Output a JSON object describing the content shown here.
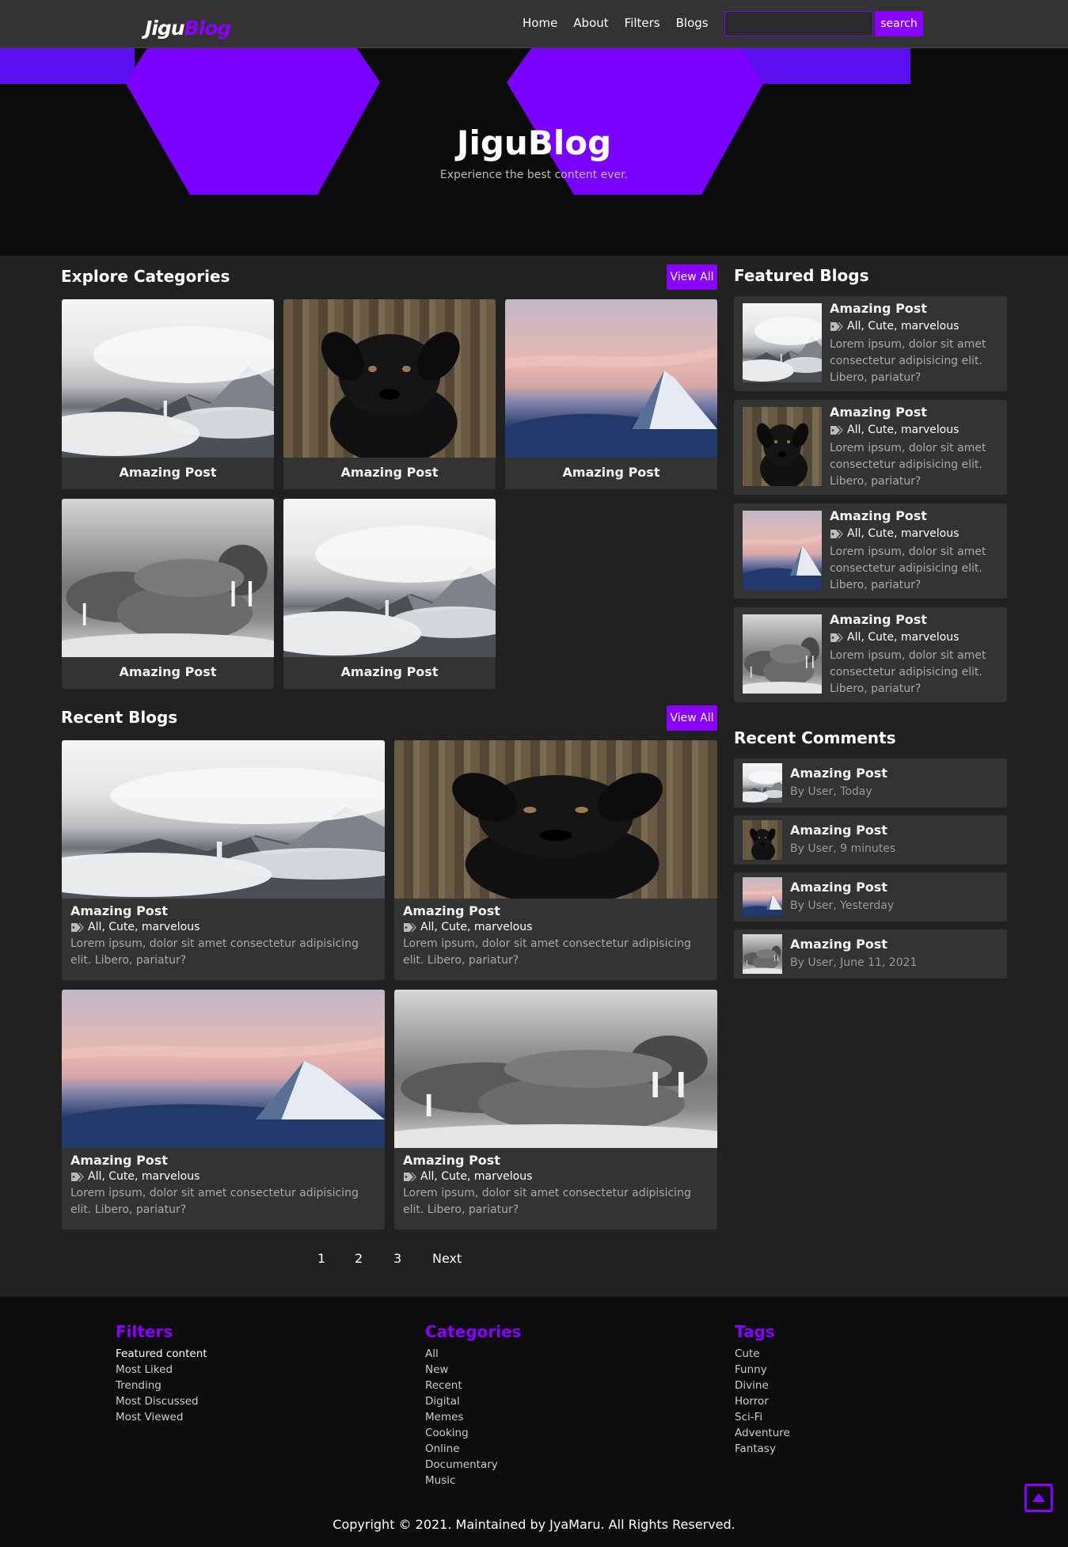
{
  "brand": {
    "logo_part1": "Jigu",
    "logo_part2": "Blog"
  },
  "nav": {
    "items": [
      "Home",
      "About",
      "Filters",
      "Blogs"
    ]
  },
  "search": {
    "placeholder": "",
    "button_label": "search"
  },
  "hero": {
    "title": "JiguBlog",
    "subtitle": "Experience the best content ever."
  },
  "explore": {
    "title": "Explore Categories",
    "view_all": "View All",
    "items": [
      {
        "label": "Amazing Post",
        "image": "mountain"
      },
      {
        "label": "Amazing Post",
        "image": "dog"
      },
      {
        "label": "Amazing Post",
        "image": "peak"
      },
      {
        "label": "Amazing Post",
        "image": "walrus"
      },
      {
        "label": "Amazing Post",
        "image": "mountain"
      }
    ]
  },
  "recent": {
    "title": "Recent Blogs",
    "view_all": "View All",
    "posts": [
      {
        "title": "Amazing Post",
        "tags": "All, Cute, marvelous",
        "desc": "Lorem ipsum, dolor sit amet consectetur adipisicing elit. Libero, pariatur?",
        "image": "mountain"
      },
      {
        "title": "Amazing Post",
        "tags": "All, Cute, marvelous",
        "desc": "Lorem ipsum, dolor sit amet consectetur adipisicing elit. Libero, pariatur?",
        "image": "dog"
      },
      {
        "title": "Amazing Post",
        "tags": "All, Cute, marvelous",
        "desc": "Lorem ipsum, dolor sit amet consectetur adipisicing elit. Libero, pariatur?",
        "image": "peak"
      },
      {
        "title": "Amazing Post",
        "tags": "All, Cute, marvelous",
        "desc": "Lorem ipsum, dolor sit amet consectetur adipisicing elit. Libero, pariatur?",
        "image": "walrus"
      }
    ]
  },
  "featured": {
    "title": "Featured Blogs",
    "posts": [
      {
        "title": "Amazing Post",
        "tags": "All, Cute, marvelous",
        "desc": "Lorem ipsum, dolor sit amet consectetur adipisicing elit. Libero, pariatur?",
        "image": "mountain"
      },
      {
        "title": "Amazing Post",
        "tags": "All, Cute, marvelous",
        "desc": "Lorem ipsum, dolor sit amet consectetur adipisicing elit. Libero, pariatur?",
        "image": "dog"
      },
      {
        "title": "Amazing Post",
        "tags": "All, Cute, marvelous",
        "desc": "Lorem ipsum, dolor sit amet consectetur adipisicing elit. Libero, pariatur?",
        "image": "peak"
      },
      {
        "title": "Amazing Post",
        "tags": "All, Cute, marvelous",
        "desc": "Lorem ipsum, dolor sit amet consectetur adipisicing elit. Libero, pariatur?",
        "image": "walrus"
      }
    ]
  },
  "comments": {
    "title": "Recent Comments",
    "items": [
      {
        "title": "Amazing Post",
        "meta": "By User, Today",
        "image": "mountain"
      },
      {
        "title": "Amazing Post",
        "meta": "By User, 9 minutes",
        "image": "dog"
      },
      {
        "title": "Amazing Post",
        "meta": "By User, Yesterday",
        "image": "peak"
      },
      {
        "title": "Amazing Post",
        "meta": "By User, June 11, 2021",
        "image": "walrus"
      }
    ]
  },
  "pagination": {
    "pages": [
      "1",
      "2",
      "3"
    ],
    "next": "Next"
  },
  "footer": {
    "filters": {
      "title": "Filters",
      "items": [
        "Featured content",
        "Most Liked",
        "Trending",
        "Most Discussed",
        "Most Viewed"
      ]
    },
    "categories": {
      "title": "Categories",
      "items": [
        "All",
        "New",
        "Recent",
        "Digital",
        "Memes",
        "Cooking",
        "Online",
        "Documentary",
        "Music"
      ]
    },
    "tags": {
      "title": "Tags",
      "items": [
        "Cute",
        "Funny",
        "Divine",
        "Horror",
        "Sci-Fi",
        "Adventure",
        "Fantasy"
      ]
    },
    "copyright": "Copyright © 2021. Maintained by JyaMaru. All Rights Reserved."
  },
  "icons": {
    "tag": "tag-icon",
    "scroll_top": "chevron-up-icon"
  },
  "colors": {
    "accent": "#8a00ff",
    "background": "#212121",
    "card": "#333333",
    "hero": "#0b0b0b"
  }
}
